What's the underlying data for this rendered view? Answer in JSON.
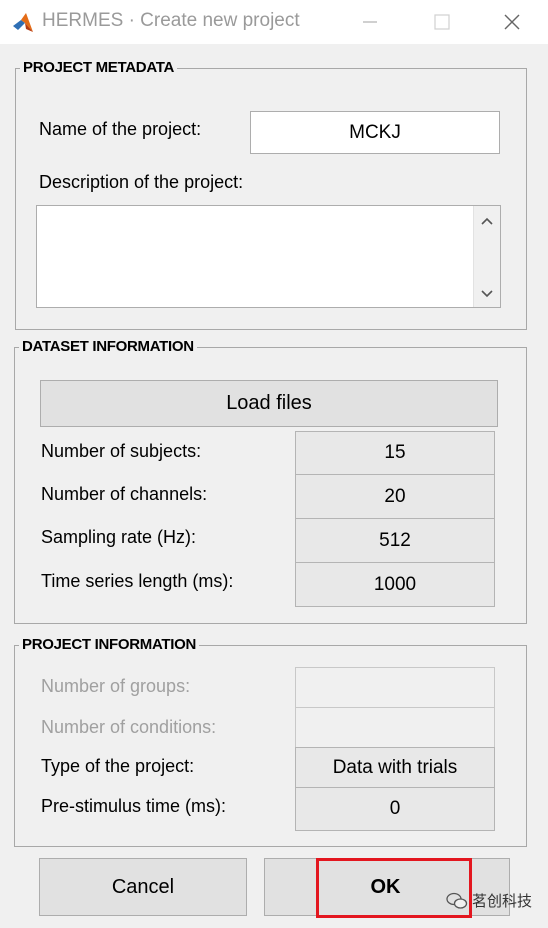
{
  "window": {
    "title": "HERMES · Create new project",
    "controls": [
      "minimize",
      "maximize",
      "close"
    ]
  },
  "project_metadata": {
    "section_title": "PROJECT METADATA",
    "name_label": "Name of the project:",
    "name_value": "MCKJ",
    "description_label": "Description of the project:",
    "description_value": ""
  },
  "dataset_information": {
    "section_title": "DATASET INFORMATION",
    "load_files_label": "Load files",
    "rows": [
      {
        "label": "Number of subjects:",
        "value": "15"
      },
      {
        "label": "Number of channels:",
        "value": "20"
      },
      {
        "label": "Sampling rate (Hz):",
        "value": "512"
      },
      {
        "label": "Time series length (ms):",
        "value": "1000"
      }
    ]
  },
  "project_information": {
    "section_title": "PROJECT INFORMATION",
    "rows": [
      {
        "label": "Number of groups:",
        "value": "",
        "enabled": false
      },
      {
        "label": "Number of conditions:",
        "value": "",
        "enabled": false
      },
      {
        "label": "Type of the project:",
        "value": "Data with trials",
        "enabled": true
      },
      {
        "label": "Pre-stimulus time (ms):",
        "value": "0",
        "enabled": true
      }
    ]
  },
  "buttons": {
    "cancel_label": "Cancel",
    "ok_label": "OK"
  },
  "watermark": {
    "text": "茗创科技"
  },
  "colors": {
    "highlight": "#e3161f",
    "panel_border": "#a8a8a8",
    "disabled_text": "#a0a0a0"
  }
}
